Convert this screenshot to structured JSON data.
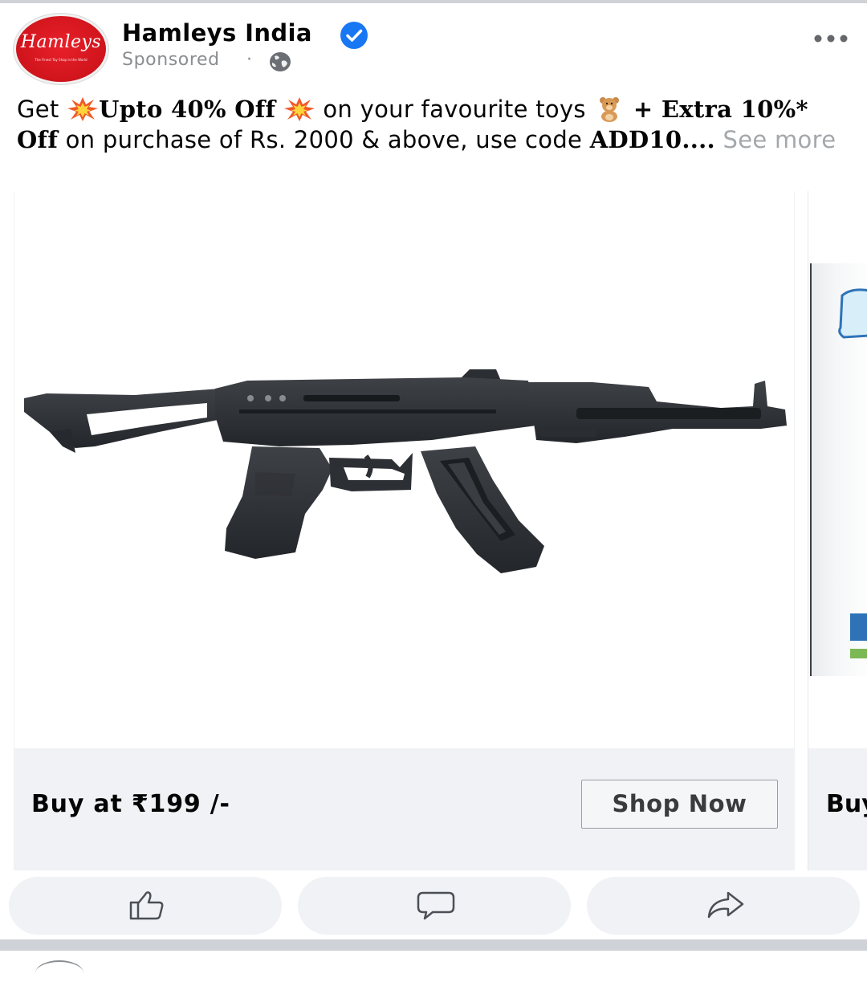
{
  "post": {
    "page_name": "Hamleys India",
    "avatar_logo": "Hamleys",
    "avatar_tagline": "The Finest Toy Shop in the World",
    "sponsored_label": "Sponsored",
    "separator": "·",
    "caption": {
      "get": "Get ",
      "offer": "Upto 40% Off",
      "middle": " on your favourite toys ",
      "extra": "+ Extra 10%* Off",
      "condition": " on purchase of Rs. 2000 & above, use code ",
      "code": "ADD10....",
      "see_more": "See more"
    }
  },
  "carousel": {
    "cards": [
      {
        "title": "Buy at ₹199 /-",
        "button_label": "Shop Now"
      },
      {
        "title": "Buy"
      }
    ]
  },
  "colors": {
    "brand_red": "#d0141c",
    "verified_blue": "#1877f2",
    "footer_gray": "#f0f2f5",
    "muted_text": "#8a8d91"
  },
  "icons": {
    "verified": "verified-badge-icon",
    "globe": "globe-icon",
    "more": "more-options-icon",
    "like": "like-icon",
    "comment": "comment-icon",
    "share": "share-icon",
    "explosion": "collision-emoji-icon",
    "teddy": "teddy-bear-emoji-icon"
  }
}
